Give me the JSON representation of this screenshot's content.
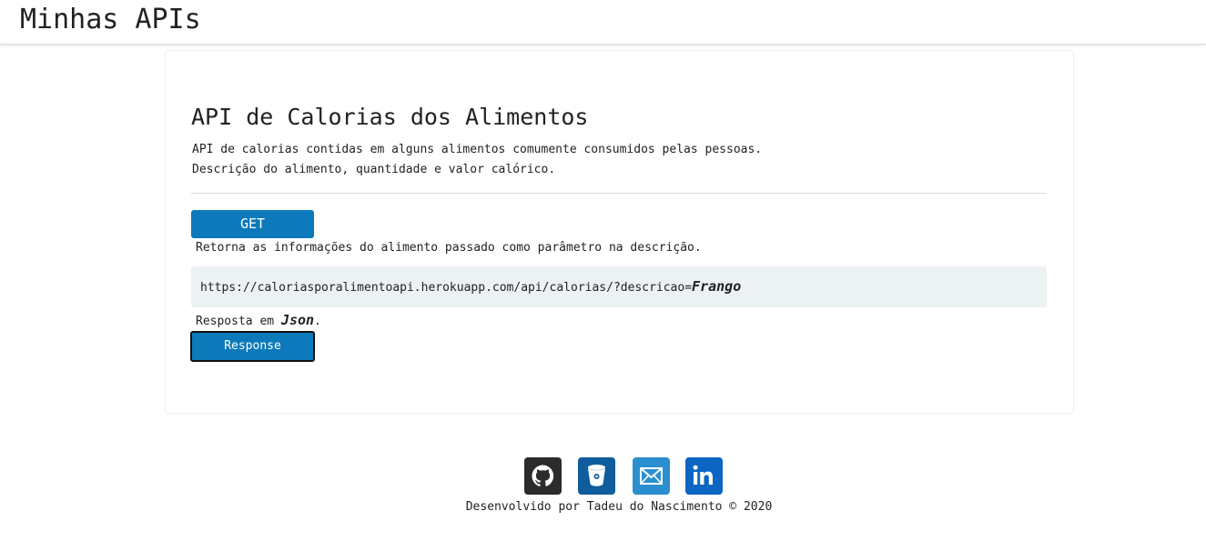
{
  "header": {
    "title": "Minhas APIs"
  },
  "api": {
    "title": "API de Calorias dos Alimentos",
    "description_lines": [
      "API de calorias contidas em alguns alimentos comumente consumidos pelas pessoas.",
      "Descrição do alimento, quantidade e valor calórico."
    ],
    "endpoint": {
      "method": "GET",
      "description": "Retorna as informações do alimento passado como parâmetro na descrição.",
      "url": "https://caloriasporalimentoapi.herokuapp.com/api/calorias/?descricao=",
      "param_example": "Frango",
      "response_prefix": "Resposta em ",
      "response_format": "Json",
      "response_suffix": ".",
      "response_button_label": "Response"
    }
  },
  "footer": {
    "social": [
      {
        "name": "GitHub",
        "icon": "github-icon",
        "color": "#2b2b2b"
      },
      {
        "name": "Bitbucket",
        "icon": "bitbucket-icon",
        "color": "#0f5d9c"
      },
      {
        "name": "Email",
        "icon": "envelope-icon",
        "color": "#2b8fcf"
      },
      {
        "name": "LinkedIn",
        "icon": "linkedin-icon",
        "color": "#0a66c2"
      }
    ],
    "credit": "Desenvolvido por Tadeu do Nascimento © 2020"
  },
  "colors": {
    "accent": "#0c79bb",
    "code_background": "#ecf1f3",
    "text": "#222222"
  }
}
